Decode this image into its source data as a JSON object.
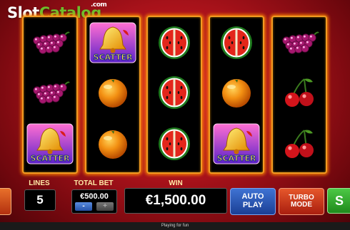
{
  "logo": {
    "part1": "Slot",
    "part2": "Catalog",
    "domain": ".com"
  },
  "reels": [
    [
      "grapes-icon",
      "grapes-icon",
      "scatter-icon"
    ],
    [
      "scatter-icon",
      "orange-icon",
      "orange-icon"
    ],
    [
      "watermelon-icon",
      "watermelon-icon",
      "watermelon-icon"
    ],
    [
      "watermelon-icon",
      "orange-icon",
      "scatter-icon"
    ],
    [
      "grapes-icon",
      "cherries-icon",
      "cherries-icon"
    ]
  ],
  "scatter_text": "SCATTER",
  "controls": {
    "lines_label": "LINES",
    "lines_value": "5",
    "total_bet_label": "TOTAL BET",
    "total_bet_value": "€500.00",
    "minus": "-",
    "plus": "+",
    "win_label": "WIN",
    "win_value": "€1,500.00",
    "autoplay_label": "AUTO PLAY",
    "turbo_label_1": "TURBO",
    "turbo_label_2": "MODE",
    "spin_label": "S"
  },
  "footer": {
    "text": "Playing for fun"
  },
  "colors": {
    "reel_border": "#f19a22",
    "autoplay": "#1e4fb0",
    "turbo": "#c8391b",
    "spin": "#2ea52a"
  }
}
